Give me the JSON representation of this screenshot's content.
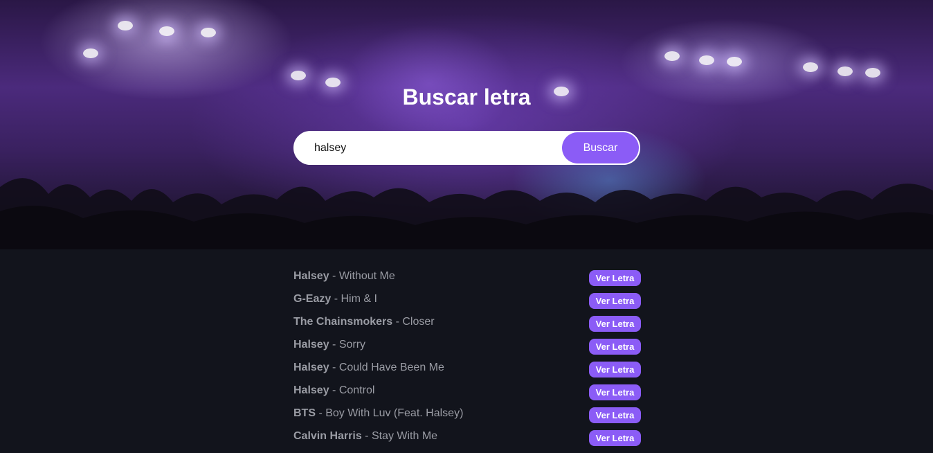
{
  "hero": {
    "title": "Buscar letra",
    "background_image": "concert-crowd-purple-stage-lights"
  },
  "search": {
    "value": "halsey",
    "button_label": "Buscar"
  },
  "results": [
    {
      "artist": "Halsey",
      "separator": " - ",
      "title": "Without Me",
      "button_label": "Ver Letra"
    },
    {
      "artist": "G-Eazy",
      "separator": " - ",
      "title": "Him & I",
      "button_label": "Ver Letra"
    },
    {
      "artist": "The Chainsmokers",
      "separator": " - ",
      "title": "Closer",
      "button_label": "Ver Letra"
    },
    {
      "artist": "Halsey",
      "separator": " - ",
      "title": "Sorry",
      "button_label": "Ver Letra"
    },
    {
      "artist": "Halsey",
      "separator": " - ",
      "title": "Could Have Been Me",
      "button_label": "Ver Letra"
    },
    {
      "artist": "Halsey",
      "separator": " - ",
      "title": "Control",
      "button_label": "Ver Letra"
    },
    {
      "artist": "BTS",
      "separator": " - ",
      "title": "Boy With Luv (Feat. Halsey)",
      "button_label": "Ver Letra"
    },
    {
      "artist": "Calvin Harris",
      "separator": " - ",
      "title": "Stay With Me",
      "button_label": "Ver Letra"
    }
  ],
  "colors": {
    "accent": "#8b5cf6",
    "page_background": "#12141c",
    "result_text": "#9a9ca4"
  }
}
